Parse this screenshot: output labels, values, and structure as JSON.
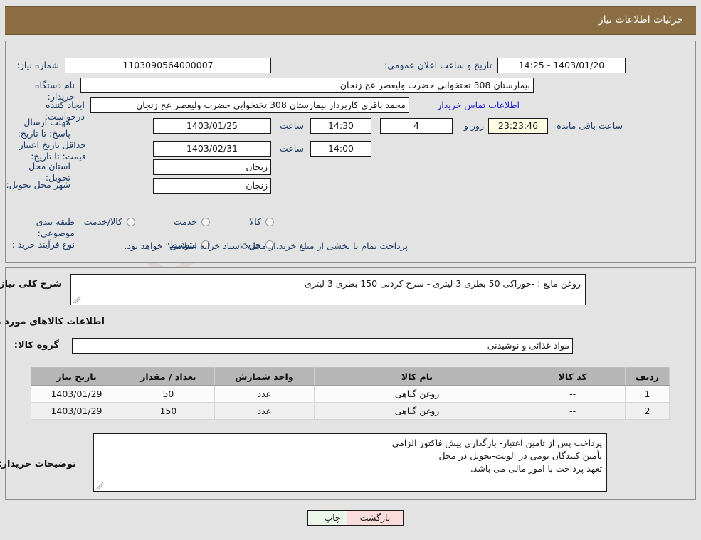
{
  "header": {
    "title": "جزئیات اطلاعات نیاز",
    "bar_color": "#8b6f43"
  },
  "watermark": {
    "text": "AriaTender",
    "suffix": ".net"
  },
  "top_form": {
    "need_number_label": "شماره نیاز:",
    "need_number_value": "1103090564000007",
    "announce_label": "تاریخ و ساعت اعلان عمومی:",
    "announce_value": "14:25 - 1403/01/20",
    "buyer_org_label": "نام دستگاه خریدار:",
    "buyer_org_value": "بیمارستان 308 تختخوابی حضرت ولیعصر عج  زنجان",
    "creator_label": "ایجاد کننده درخواست:",
    "creator_value": "محمد باقری کاربرداز بیمارستان 308 تختخوابی حضرت ولیعصر عج  زنجان",
    "contact_link": "اطلاعات تماس خریدار",
    "deadline_label": "مهلت ارسال پاسخ: تا تاریخ:",
    "deadline_date": "1403/01/25",
    "deadline_hour_label": "ساعت",
    "deadline_hour": "14:30",
    "remaining_days": "4",
    "remaining_days_label": "روز و",
    "remaining_time": "23:23:46",
    "remaining_time_label": "ساعت باقی مانده",
    "price_validity_label": "حداقل تاریخ اعتبار قیمت: تا تاریخ:",
    "price_validity_date": "1403/02/31",
    "price_validity_hour_label": "ساعت",
    "price_validity_hour": "14:00",
    "province_label": "استان محل تحویل:",
    "province_value": "زنجان",
    "city_label": "شهر محل تحویل:",
    "city_value": "زنجان",
    "category_label": "طبقه بندی موضوعی:",
    "category_options": [
      "کالا",
      "خدمت",
      "کالا/خدمت"
    ],
    "process_label": "نوع فرآیند خرید :",
    "process_options": [
      "جزیی",
      "متوسط"
    ],
    "process_note": "پرداخت تمام یا بخشی از مبلغ خرید،از محل \"اسناد خزانه اسلامی\" خواهد بود."
  },
  "bottom": {
    "summary_label": "شرح کلی نیاز:",
    "summary_value": "روغن مایع : -خوراکی 50 بطری 3 لیتری - سرخ کردنی 150 بطری 3 لیتری",
    "goods_section_title": "اطلاعات کالاهای مورد نیاز",
    "goods_group_label": "گروه کالا:",
    "goods_group_value": "مواد غذائی و نوشیدنی",
    "table": {
      "columns": [
        "ردیف",
        "کد کالا",
        "نام کالا",
        "واحد شمارش",
        "تعداد / مقدار",
        "تاریخ نیاز"
      ],
      "rows": [
        {
          "row": "1",
          "code": "--",
          "name": "روغن گیاهی",
          "unit": "عدد",
          "qty": "50",
          "date": "1403/01/29"
        },
        {
          "row": "2",
          "code": "--",
          "name": "روغن گیاهی",
          "unit": "عدد",
          "qty": "150",
          "date": "1403/01/29"
        }
      ]
    },
    "buyer_notes_label": "توضیحات خریدار:",
    "buyer_notes_lines": [
      "پرداخت پس از تامین اعتبار- بارگذاری پیش فاکتور الزامی",
      "تأمین کنندگان بومی در الویت-تحویل در محل",
      "تعهد پرداخت با امور مالی می باشد."
    ]
  },
  "footer": {
    "print_label": "چاپ",
    "back_label": "بازگشت"
  }
}
